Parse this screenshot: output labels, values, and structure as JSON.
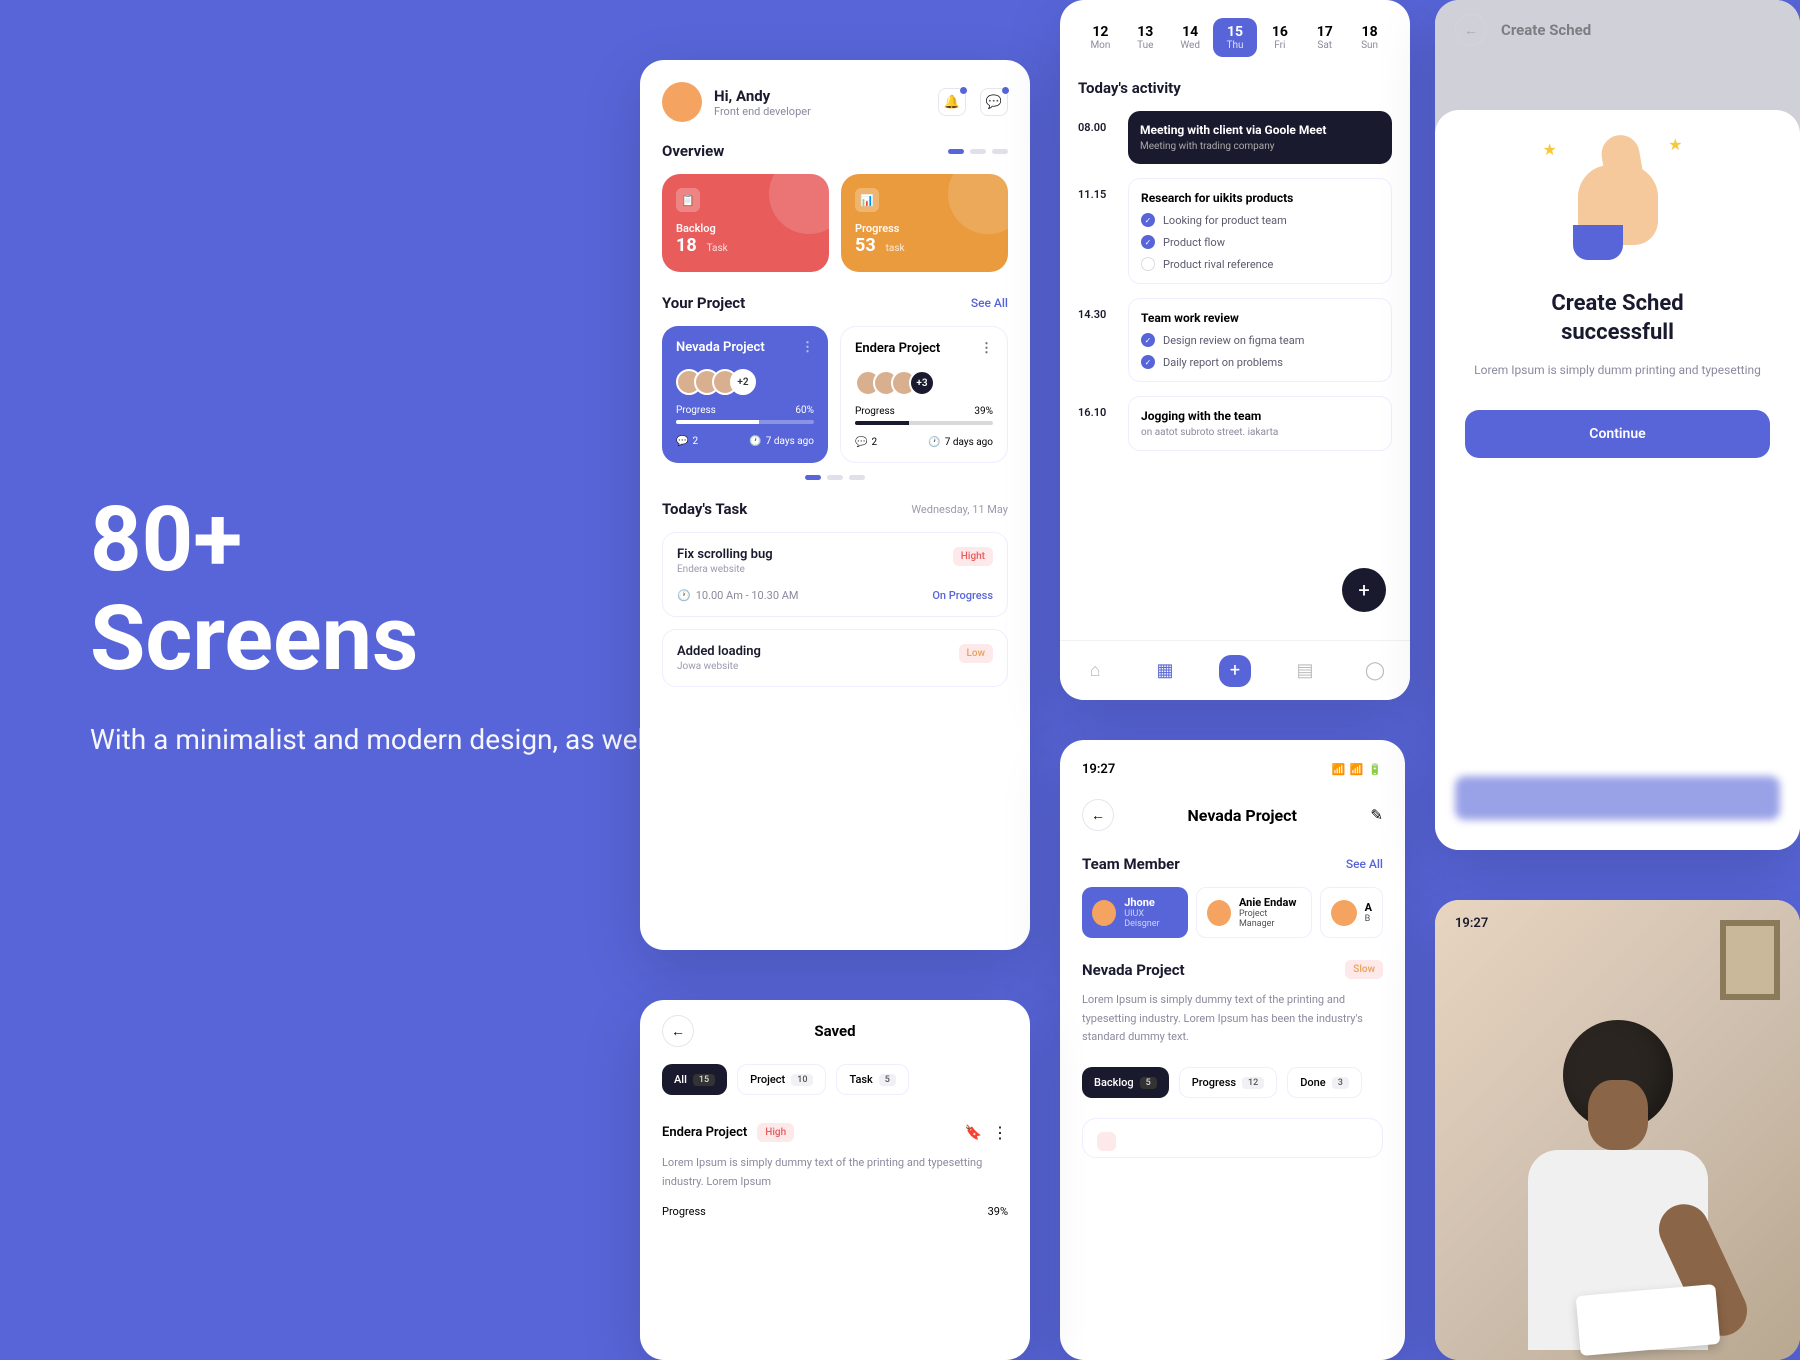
{
  "hero": {
    "title_line1": "80+",
    "title_line2": "Screens",
    "subtitle": "With a minimalist and modern design, as well as Neatly & Organized Layer"
  },
  "dashboard": {
    "greeting": "Hi, Andy",
    "role": "Front end developer",
    "overview_label": "Overview",
    "cards": {
      "backlog": {
        "label": "Backlog",
        "count": "18",
        "unit": "Task"
      },
      "progress": {
        "label": "Progress",
        "count": "53",
        "unit": "task"
      }
    },
    "your_project_label": "Your Project",
    "see_all": "See All",
    "projects": [
      {
        "name": "Nevada Project",
        "progress_label": "Progress",
        "percent": "60%",
        "extra": "+2",
        "comments": "2",
        "age": "7 days ago"
      },
      {
        "name": "Endera Project",
        "progress_label": "Progress",
        "percent": "39%",
        "extra": "+3",
        "comments": "2",
        "age": "7 days ago"
      }
    ],
    "today_task_label": "Today's Task",
    "today_date": "Wednesday, 11 May",
    "tasks": [
      {
        "title": "Fix scrolling bug",
        "site": "Endera website",
        "priority": "Hight",
        "time": "10.00 Am - 10.30 AM",
        "status": "On Progress"
      },
      {
        "title": "Added loading",
        "site": "Jowa website",
        "priority": "Low"
      }
    ]
  },
  "calendar": {
    "days": [
      {
        "num": "12",
        "name": "Mon"
      },
      {
        "num": "13",
        "name": "Tue"
      },
      {
        "num": "14",
        "name": "Wed"
      },
      {
        "num": "15",
        "name": "Thu"
      },
      {
        "num": "16",
        "name": "Fri"
      },
      {
        "num": "17",
        "name": "Sat"
      },
      {
        "num": "18",
        "name": "Sun"
      }
    ],
    "activity_label": "Today's activity",
    "items": [
      {
        "time": "08.00",
        "title": "Meeting with client via Goole Meet",
        "sub": "Meeting with trading company"
      },
      {
        "time": "11.15",
        "title": "Research for uikits products",
        "checks": [
          "Looking for product team",
          "Product flow",
          "Product rival reference"
        ]
      },
      {
        "time": "14.30",
        "title": "Team work review",
        "checks": [
          "Design review on figma team",
          "Daily report on problems"
        ]
      },
      {
        "time": "16.10",
        "title": "Jogging with the team",
        "sub": "on aatot subroto street. iakarta"
      }
    ]
  },
  "project_detail": {
    "time": "19:27",
    "title": "Nevada Project",
    "team_label": "Team Member",
    "see_all": "See All",
    "members": [
      {
        "name": "Jhone",
        "role": "UIUX Deisgner"
      },
      {
        "name": "Anie Endaw",
        "role": "Project Manager"
      },
      {
        "name": "A",
        "role": "B"
      }
    ],
    "name": "Nevada Project",
    "status": "Slow",
    "desc": "Lorem Ipsum is simply dummy text of the printing and typesetting industry. Lorem Ipsum has been the industry's standard dummy text.",
    "filters": [
      {
        "label": "Backlog",
        "count": "5"
      },
      {
        "label": "Progress",
        "count": "12"
      },
      {
        "label": "Done",
        "count": "3"
      }
    ]
  },
  "saved": {
    "title": "Saved",
    "filters": [
      {
        "label": "All",
        "count": "15"
      },
      {
        "label": "Project",
        "count": "10"
      },
      {
        "label": "Task",
        "count": "5"
      }
    ],
    "item": {
      "name": "Endera Project",
      "priority": "High",
      "desc": "Lorem Ipsum is simply dummy text of the printing and typesetting industry. Lorem Ipsum",
      "progress_label": "Progress",
      "percent": "39%"
    }
  },
  "modal": {
    "title_line1": "Create Sched",
    "title_line2": "successfull",
    "sub": "Lorem Ipsum is simply dumm printing and typesetting",
    "button": "Continue",
    "header_label": "Create Sched"
  },
  "photo": {
    "time": "19:27"
  }
}
